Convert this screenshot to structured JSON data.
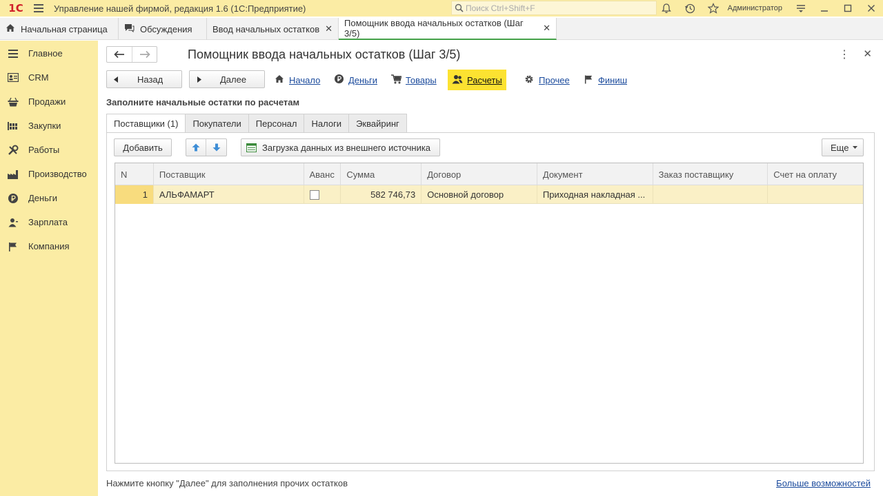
{
  "app": {
    "title": "Управление нашей фирмой, редакция 1.6  (1С:Предприятие)",
    "logo": "1С",
    "search_placeholder": "Поиск Ctrl+Shift+F",
    "user": "Администратор",
    "icons": [
      "bell-icon",
      "history-icon",
      "star-icon",
      "settings-menu-icon",
      "minimize-icon",
      "maximize-icon",
      "close-icon"
    ]
  },
  "window_tabs": [
    {
      "label": "Начальная страница",
      "icon": "home-icon"
    },
    {
      "label": "Обсуждения",
      "icon": "chat-icon"
    },
    {
      "label": "Ввод начальных остатков",
      "closable": true
    },
    {
      "label": "Помощник ввода начальных остатков (Шаг 3/5)",
      "closable": true,
      "active": true
    }
  ],
  "sidebar": {
    "items": [
      {
        "label": "Главное",
        "icon": "menu-icon"
      },
      {
        "label": "CRM",
        "icon": "crm-icon"
      },
      {
        "label": "Продажи",
        "icon": "basket-icon"
      },
      {
        "label": "Закупки",
        "icon": "purchases-icon"
      },
      {
        "label": "Работы",
        "icon": "tools-icon"
      },
      {
        "label": "Производство",
        "icon": "factory-icon"
      },
      {
        "label": "Деньги",
        "icon": "ruble-icon"
      },
      {
        "label": "Зарплата",
        "icon": "person-icon"
      },
      {
        "label": "Компания",
        "icon": "flag-icon"
      }
    ]
  },
  "form": {
    "title": "Помощник ввода начальных остатков (Шаг 3/5)",
    "back_label": "Назад",
    "next_label": "Далее",
    "steps": [
      {
        "label": "Начало",
        "icon": "home-icon"
      },
      {
        "label": "Деньги",
        "icon": "ruble-icon"
      },
      {
        "label": "Товары",
        "icon": "cart-icon"
      },
      {
        "label": "Расчеты",
        "icon": "people-icon",
        "active": true
      },
      {
        "label": "Прочее",
        "icon": "gear-icon"
      },
      {
        "label": "Финиш",
        "icon": "flag-icon"
      }
    ],
    "subtitle": "Заполните начальные остатки по расчетам",
    "page_tabs": [
      "Поставщики (1)",
      "Покупатели",
      "Персонал",
      "Налоги",
      "Эквайринг"
    ],
    "toolbar": {
      "add_label": "Добавить",
      "load_label": "Загрузка данных из внешнего источника",
      "more_label": "Еще"
    },
    "table": {
      "columns": [
        "N",
        "Поставщик",
        "Аванс",
        "Сумма",
        "Договор",
        "Документ",
        "Заказ поставщику",
        "Счет на оплату"
      ],
      "rows": [
        {
          "n": "1",
          "supplier": "АЛЬФАМАРТ",
          "advance": false,
          "amount": "582 746,73",
          "contract": "Основной договор",
          "document": "Приходная накладная ...",
          "order": "",
          "invoice": ""
        }
      ]
    },
    "footer_hint": "Нажмите кнопку \"Далее\" для заполнения прочих остатков",
    "footer_link": "Больше возможностей"
  }
}
